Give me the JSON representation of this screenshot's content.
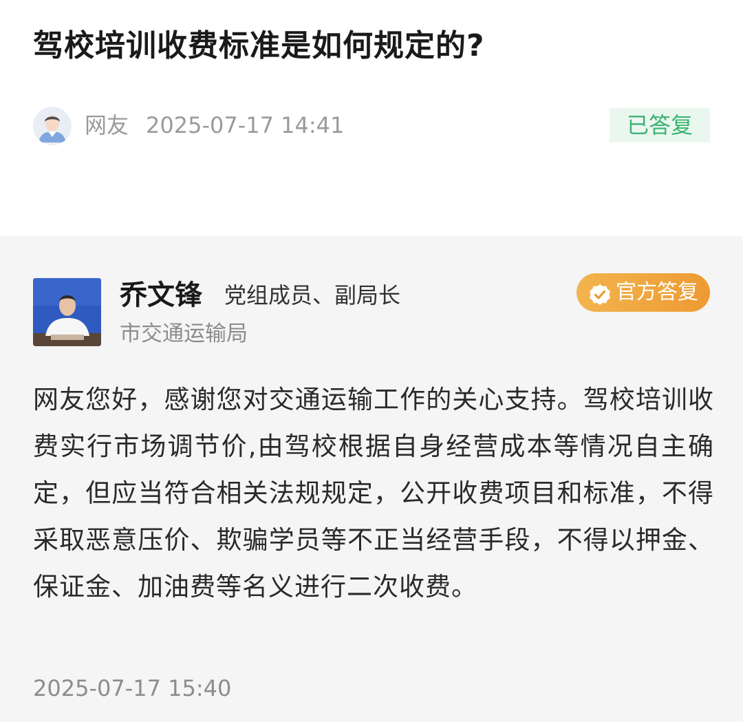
{
  "question": {
    "title": "驾校培训收费标准是如何规定的?",
    "user": "网友",
    "time": "2025-07-17 14:41",
    "status": "已答复"
  },
  "answer": {
    "name": "乔文锋",
    "role": "党组成员、副局长",
    "org": "市交通运输局",
    "badge": "官方答复",
    "body": "网友您好，感谢您对交通运输工作的关心支持。驾校培训收费实行市场调节价,由驾校根据自身经营成本等情况自主确定，但应当符合相关法规规定，公开收费项目和标准，不得采取恶意压价、欺骗学员等不正当经营手段，不得以押金、保证金、加油费等名义进行二次收费。",
    "time": "2025-07-17 15:40"
  },
  "colors": {
    "status_green": "#3cb371",
    "status_bg": "#eaf7ef",
    "official_orange": "#ee9a32",
    "answer_bg": "#f5f5f5"
  },
  "icons": {
    "user_avatar": "user-avatar-icon",
    "official_badge": "verified-check-icon"
  }
}
